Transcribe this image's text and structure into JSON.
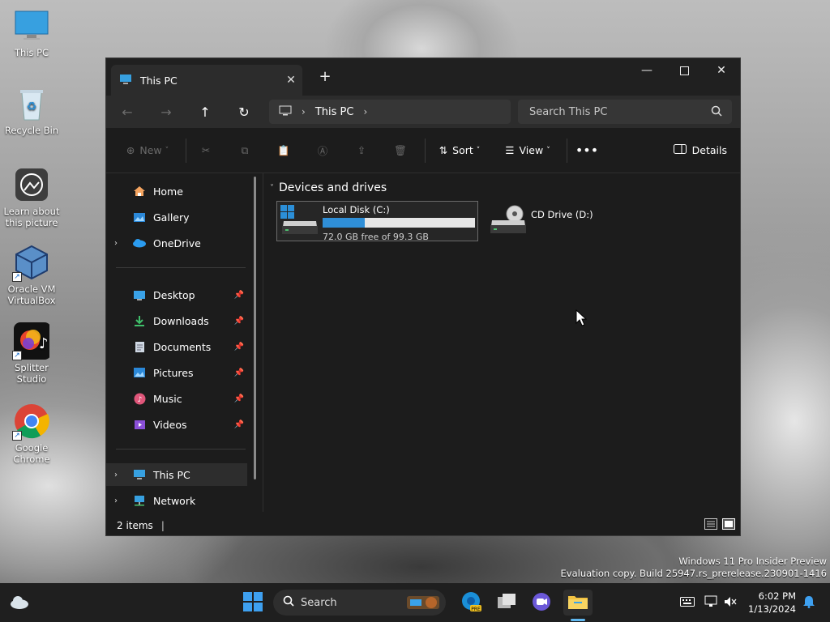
{
  "desktop": {
    "icons": [
      {
        "label": "This PC"
      },
      {
        "label": "Recycle Bin"
      },
      {
        "label": "Learn about this picture"
      },
      {
        "label": "Oracle VM VirtualBox"
      },
      {
        "label": "Splitter Studio"
      },
      {
        "label": "Google Chrome"
      }
    ],
    "watermark": {
      "line1": "Windows 11 Pro Insider Preview",
      "line2": "Evaluation copy. Build 25947.rs_prerelease.230901-1416"
    }
  },
  "window": {
    "tab_title": "This PC",
    "breadcrumb": {
      "location": "This PC"
    },
    "search": {
      "placeholder": "Search This PC"
    },
    "toolbar": {
      "new_label": "New",
      "sort_label": "Sort",
      "view_label": "View",
      "details_label": "Details"
    },
    "sidebar": {
      "items": [
        {
          "label": "Home",
          "icon": "home-icon"
        },
        {
          "label": "Gallery",
          "icon": "gallery-icon"
        },
        {
          "label": "OneDrive",
          "icon": "onedrive-icon"
        },
        {
          "label": "Desktop",
          "icon": "desktop-folder-icon"
        },
        {
          "label": "Downloads",
          "icon": "downloads-icon"
        },
        {
          "label": "Documents",
          "icon": "documents-icon"
        },
        {
          "label": "Pictures",
          "icon": "pictures-icon"
        },
        {
          "label": "Music",
          "icon": "music-icon"
        },
        {
          "label": "Videos",
          "icon": "videos-icon"
        },
        {
          "label": "This PC",
          "icon": "this-pc-icon"
        },
        {
          "label": "Network",
          "icon": "network-icon"
        }
      ]
    },
    "content": {
      "group_title": "Devices and drives",
      "drives": [
        {
          "name": "Local Disk (C:)",
          "free_text": "72.0 GB free of 99.3 GB",
          "used_fraction": 0.275
        },
        {
          "name": "CD Drive (D:)"
        }
      ]
    },
    "status": {
      "item_count": "2 items"
    }
  },
  "taskbar": {
    "search_label": "Search",
    "time": "6:02 PM",
    "date": "1/13/2024"
  },
  "colors": {
    "accent": "#2f8fd8",
    "window_bg": "#1c1c1c",
    "chrome_bg": "#2c2c2c"
  }
}
